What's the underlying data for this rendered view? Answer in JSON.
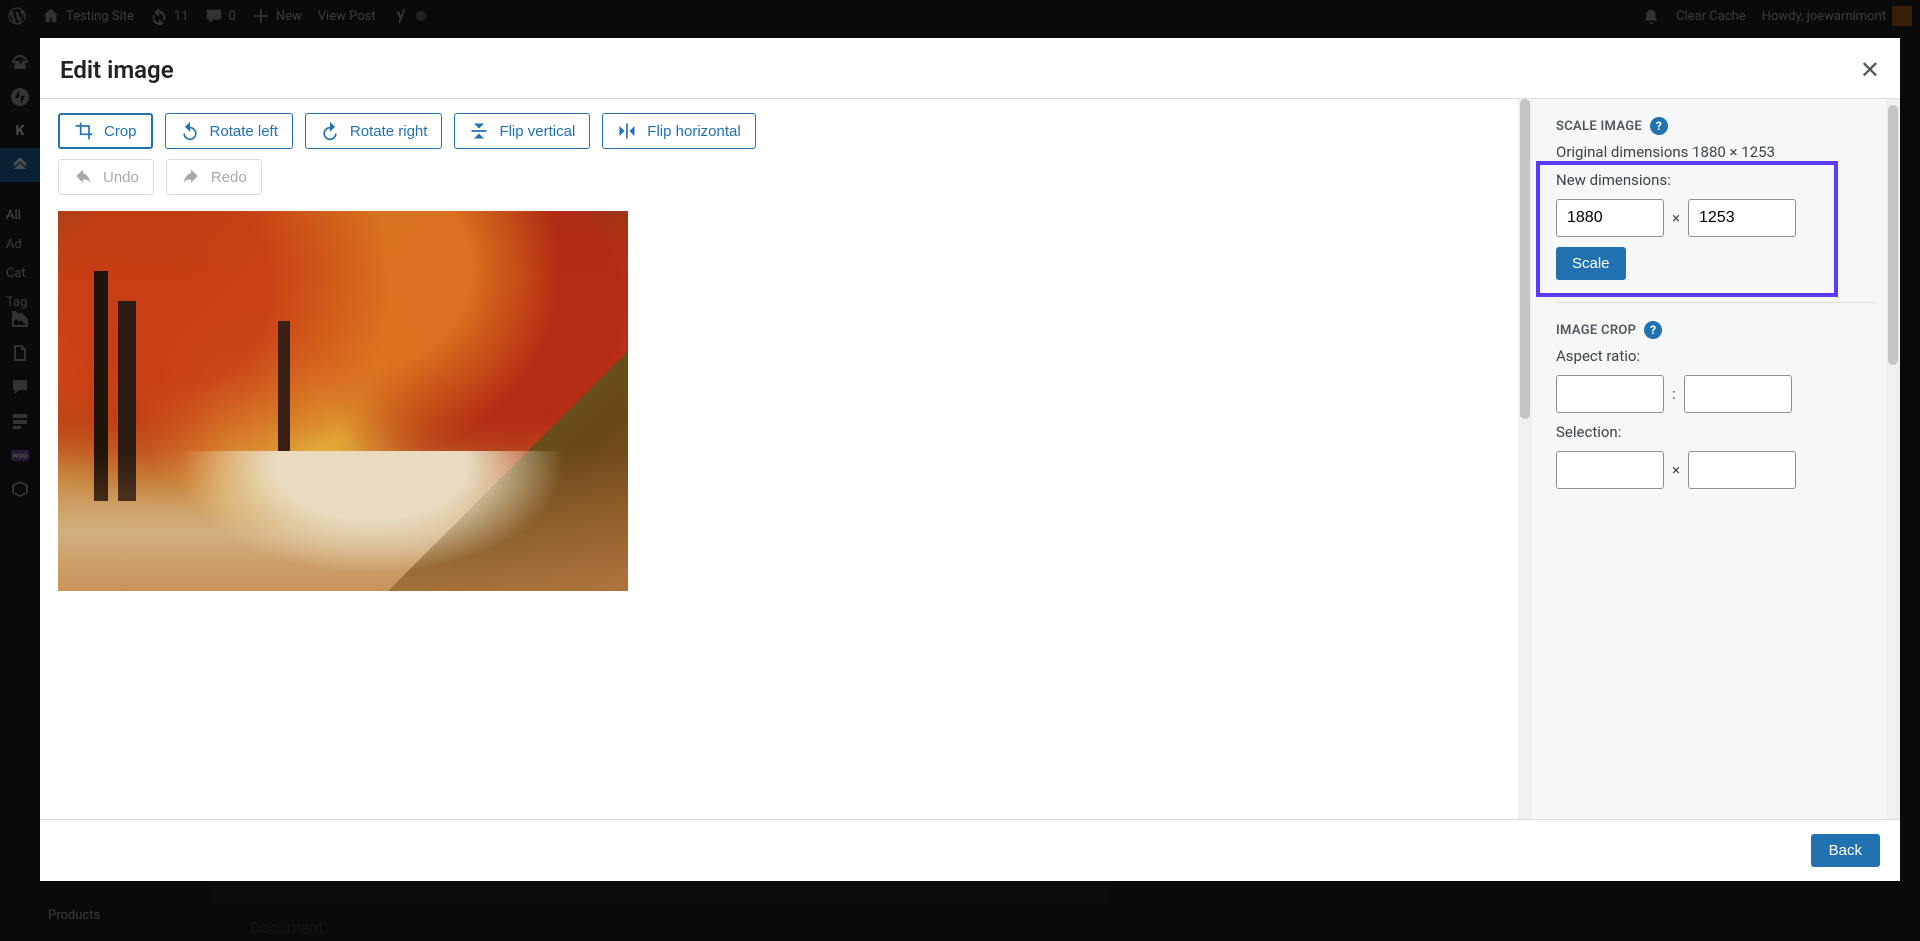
{
  "adminbar": {
    "site_title": "Testing Site",
    "updates_count": "11",
    "comments_count": "0",
    "new_label": "New",
    "view_post": "View Post",
    "clear_cache": "Clear Cache",
    "howdy": "Howdy, joewarnimont"
  },
  "submenu_peek": {
    "all": "All",
    "add": "Ad",
    "categories": "Cat",
    "tags": "Tag"
  },
  "bottom_peek": {
    "products": "Products"
  },
  "doc_peek": "Document",
  "modal": {
    "title": "Edit image",
    "toolbar": {
      "crop": "Crop",
      "rotate_left": "Rotate left",
      "rotate_right": "Rotate right",
      "flip_vertical": "Flip vertical",
      "flip_horizontal": "Flip horizontal",
      "undo": "Undo",
      "redo": "Redo"
    },
    "scale": {
      "heading": "SCALE IMAGE",
      "original_label": "Original dimensions 1880 × 1253",
      "new_dimensions_label": "New dimensions:",
      "width": "1880",
      "height": "1253",
      "button": "Scale"
    },
    "crop": {
      "heading": "IMAGE CROP",
      "aspect_label": "Aspect ratio:",
      "selection_label": "Selection:"
    },
    "footer": {
      "back": "Back"
    },
    "help": "?"
  }
}
